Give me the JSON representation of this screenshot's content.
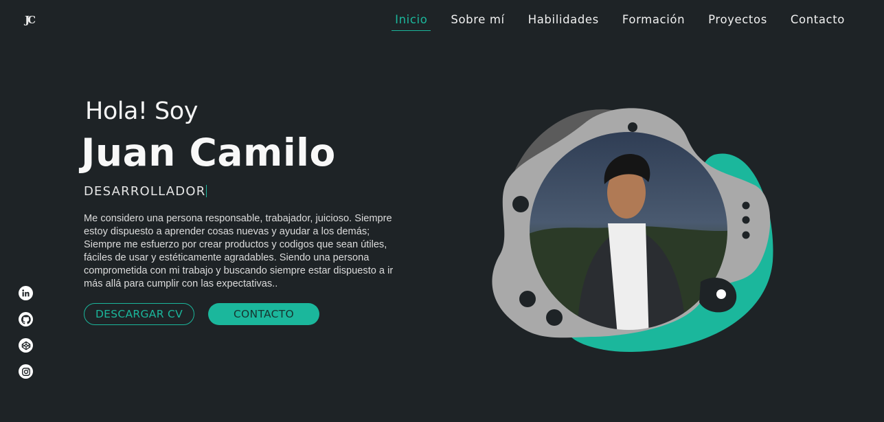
{
  "logo": "JC",
  "nav": {
    "items": [
      "Inicio",
      "Sobre mí",
      "Habilidades",
      "Formación",
      "Proyectos",
      "Contacto"
    ],
    "active": "Inicio"
  },
  "hero": {
    "greeting": "Hola! Soy",
    "name": "Juan Camilo",
    "role": "DESARROLLADOR",
    "bio": "Me considero una persona responsable, trabajador, juicioso. Siempre estoy dispuesto a aprender cosas nuevas y ayudar a los demás; Siempre me esfuerzo por crear productos y codigos que sean útiles, fáciles de usar y estéticamente agradables. Siendo una persona comprometida con mi trabajo y buscando siempre estar dispuesto a ir más allá para cumplir con las expectativas..",
    "cv_button": "DESCARGAR CV",
    "contact_button": "CONTACTO"
  },
  "social": [
    "linkedin-icon",
    "github-icon",
    "codepen-icon",
    "instagram-icon"
  ],
  "colors": {
    "background": "#1e2326",
    "accent": "#1bb79c",
    "blob_gray": "#a8a8a8",
    "blob_dark": "#5a5a5a"
  }
}
